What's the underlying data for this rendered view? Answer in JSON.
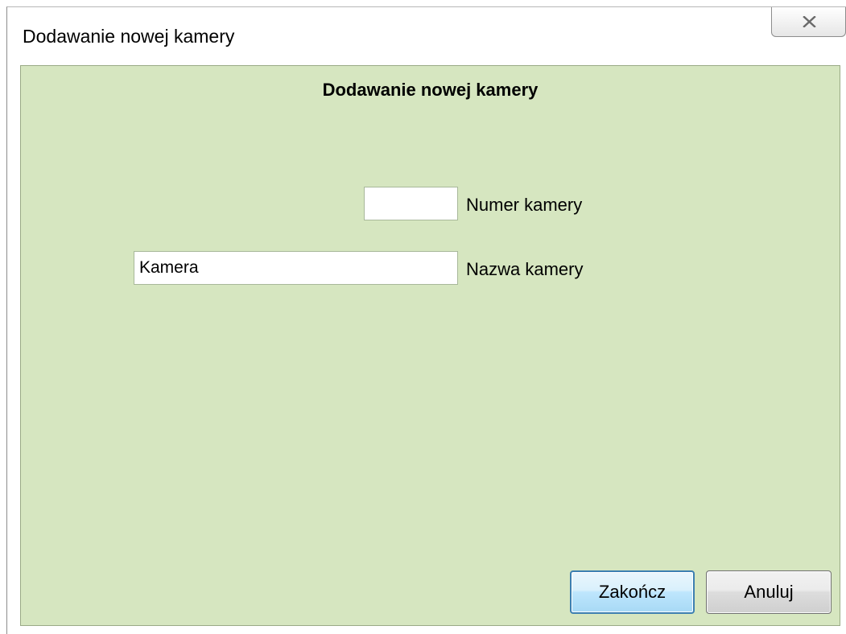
{
  "window": {
    "title": "Dodawanie nowej kamery",
    "close_icon": "close-x-icon"
  },
  "form": {
    "heading": "Dodawanie nowej kamery",
    "camera_number": {
      "value": "",
      "label": "Numer kamery"
    },
    "camera_name": {
      "value": "Kamera",
      "label": "Nazwa kamery"
    }
  },
  "buttons": {
    "finish_label": "Zakończ",
    "cancel_label": "Anuluj"
  },
  "colors": {
    "panel_background": "#d6e6c0",
    "primary_button_border": "#3c7fb1"
  }
}
